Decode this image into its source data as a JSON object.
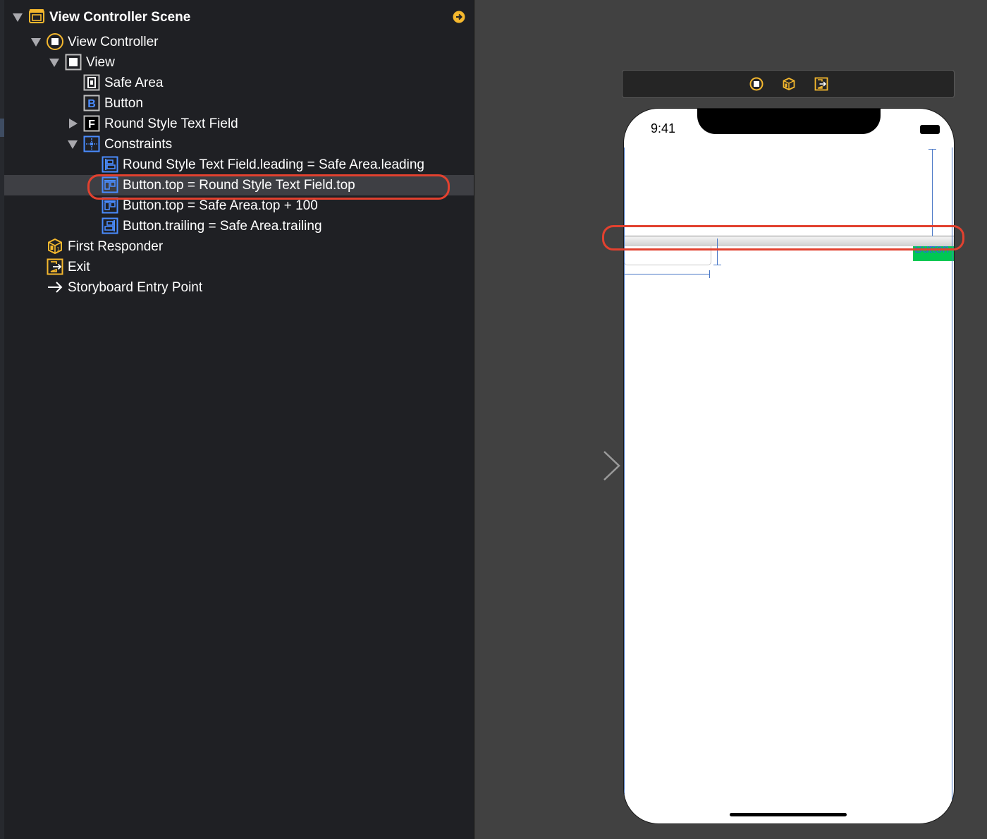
{
  "outline": {
    "items": [
      {
        "id": "scene",
        "label": "View Controller Scene",
        "icon": "scene-icon"
      },
      {
        "id": "vc",
        "label": "View Controller",
        "icon": "view-controller-icon"
      },
      {
        "id": "view",
        "label": "View",
        "icon": "view-icon"
      },
      {
        "id": "safe-area",
        "label": "Safe Area",
        "icon": "safe-area-icon"
      },
      {
        "id": "button",
        "label": "Button",
        "icon": "button-icon"
      },
      {
        "id": "text-field",
        "label": "Round Style Text Field",
        "icon": "text-field-icon"
      },
      {
        "id": "constraints",
        "label": "Constraints",
        "icon": "constraints-icon"
      },
      {
        "id": "c1",
        "label": "Round Style Text Field.leading = Safe Area.leading",
        "icon": "leading-constraint-icon"
      },
      {
        "id": "c2",
        "label": "Button.top = Round Style Text Field.top",
        "icon": "top-constraint-icon"
      },
      {
        "id": "c3",
        "label": "Button.top = Safe Area.top + 100",
        "icon": "top-constraint-icon"
      },
      {
        "id": "c4",
        "label": "Button.trailing = Safe Area.trailing",
        "icon": "trailing-constraint-icon"
      },
      {
        "id": "first-responder",
        "label": "First Responder",
        "icon": "first-responder-icon"
      },
      {
        "id": "exit",
        "label": "Exit",
        "icon": "exit-icon"
      },
      {
        "id": "entry",
        "label": "Storyboard Entry Point",
        "icon": "arrow-right-icon"
      }
    ],
    "selected": "Button.top = Round Style Text Field.top"
  },
  "canvas": {
    "dock_icons": [
      "view-controller-icon",
      "first-responder-icon",
      "exit-icon"
    ],
    "status_time": "9:41",
    "button_label": "Button"
  },
  "colors": {
    "accent_yellow": "#f5b82e",
    "constraint_blue": "#4a78c6",
    "highlight_red": "#e2412f",
    "button_green": "#00c853"
  }
}
